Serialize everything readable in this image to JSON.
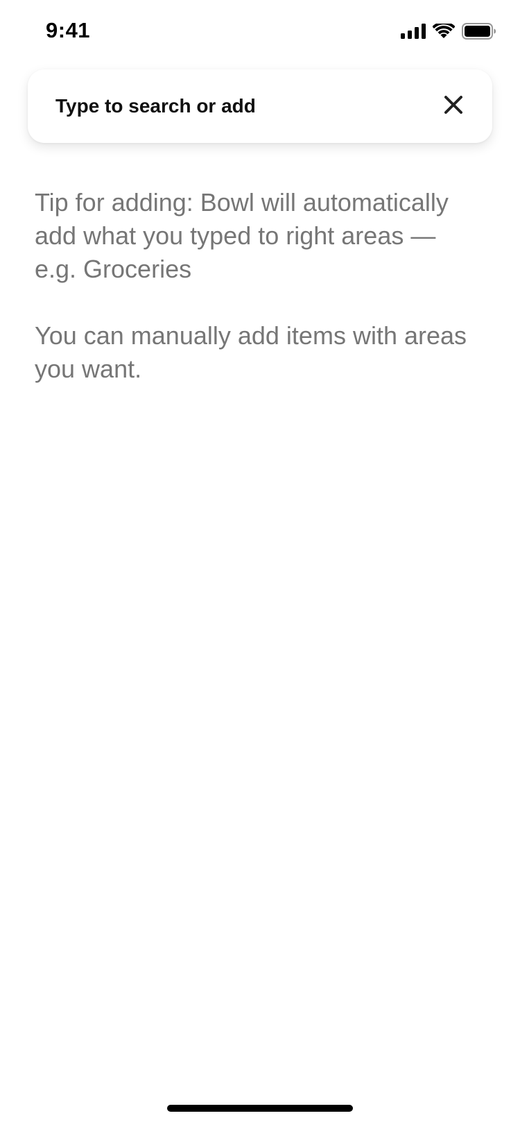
{
  "status_bar": {
    "time": "9:41",
    "icons": [
      "cellular-signal-icon",
      "wifi-icon",
      "battery-icon"
    ]
  },
  "search": {
    "placeholder": "Type to search or add",
    "value": "",
    "close_icon": "close-icon"
  },
  "tips": {
    "tip_1": "Tip for adding: Bowl will automatically add what you typed to right areas — e.g. Groceries",
    "tip_2": "You can manually add items with areas you want."
  },
  "colors": {
    "background": "#ffffff",
    "tip_text": "#767676",
    "primary_text": "#111111"
  }
}
